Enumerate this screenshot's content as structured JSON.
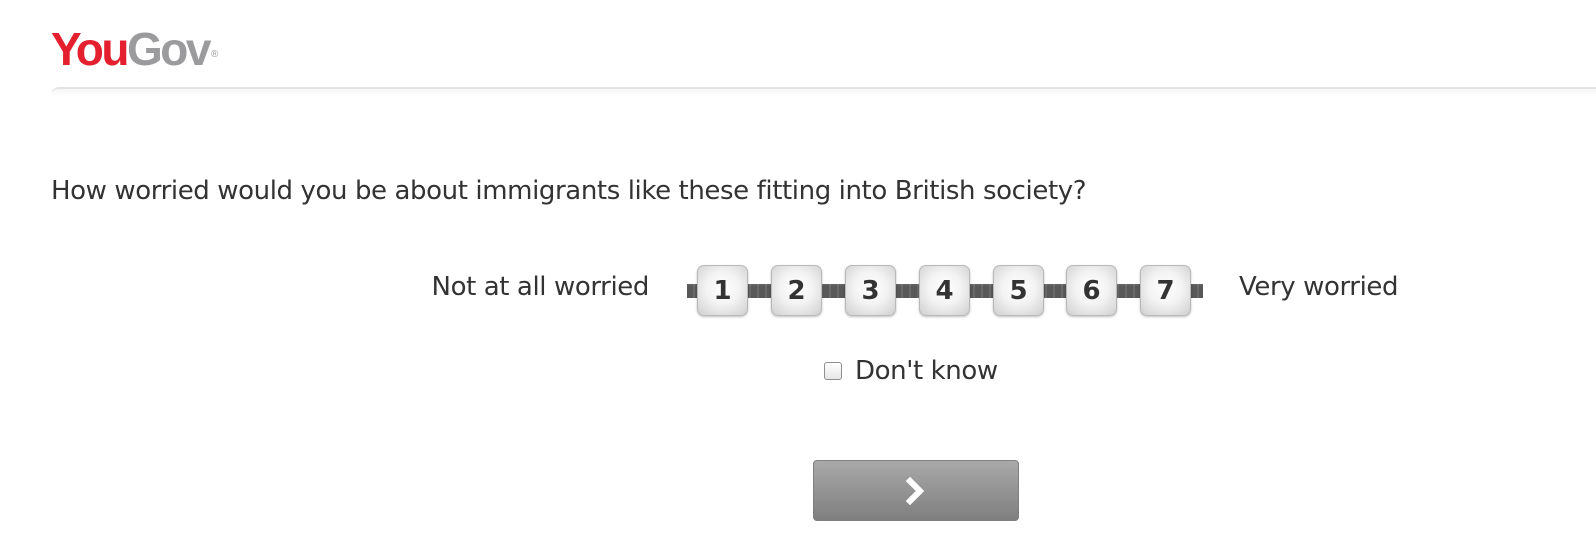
{
  "brand": {
    "logo_part1": "You",
    "logo_part2": "Gov",
    "registered_mark": "®",
    "color_red": "#e5202e",
    "color_gray": "#9b9b9e"
  },
  "question": {
    "text": "How worried would you be about immigrants like these fitting into British society?"
  },
  "scale": {
    "left_label": "Not at all worried",
    "right_label": "Very worried",
    "options": [
      "1",
      "2",
      "3",
      "4",
      "5",
      "6",
      "7"
    ]
  },
  "dont_know": {
    "label": "Don't know",
    "checked": false
  },
  "next_button": {
    "icon": "chevron-right-icon"
  }
}
